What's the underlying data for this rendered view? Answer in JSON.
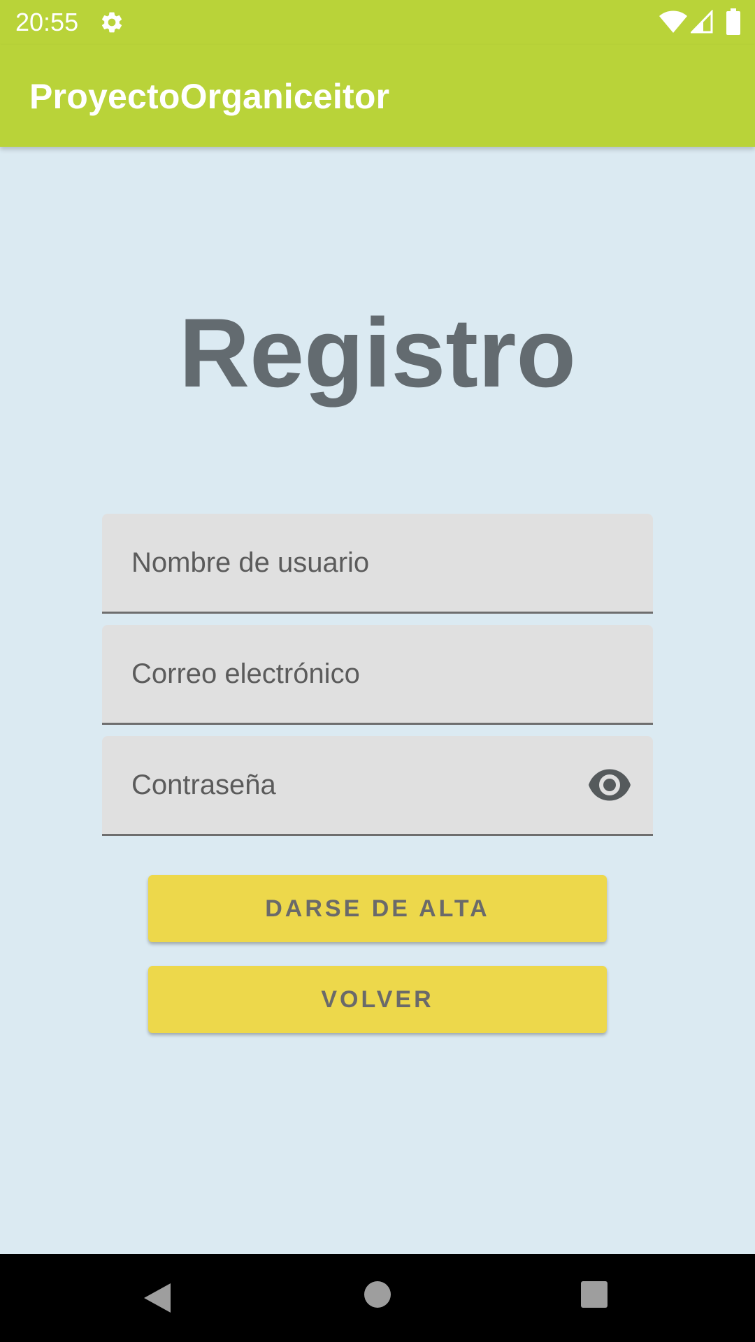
{
  "status_bar": {
    "time": "20:55",
    "icons": [
      "gear-icon",
      "wifi-icon",
      "signal-icon",
      "battery-icon"
    ]
  },
  "app_bar": {
    "title": "ProyectoOrganiceitor"
  },
  "page": {
    "title": "Registro"
  },
  "form": {
    "username": {
      "value": "",
      "placeholder": "Nombre de usuario"
    },
    "email": {
      "value": "",
      "placeholder": "Correo electrónico"
    },
    "password": {
      "value": "",
      "placeholder": "Contraseña",
      "toggle_icon": "eye-icon"
    }
  },
  "buttons": {
    "register_label": "DARSE DE ALTA",
    "back_label": "VOLVER"
  },
  "nav_bar": {
    "icons": [
      "back-triangle-icon",
      "home-circle-icon",
      "recents-square-icon"
    ]
  },
  "colors": {
    "app_bar": "#b9d339",
    "background": "#dbeaf2",
    "button": "#edd84b",
    "title_text": "#636b70",
    "field_background": "#e0e0e0"
  }
}
